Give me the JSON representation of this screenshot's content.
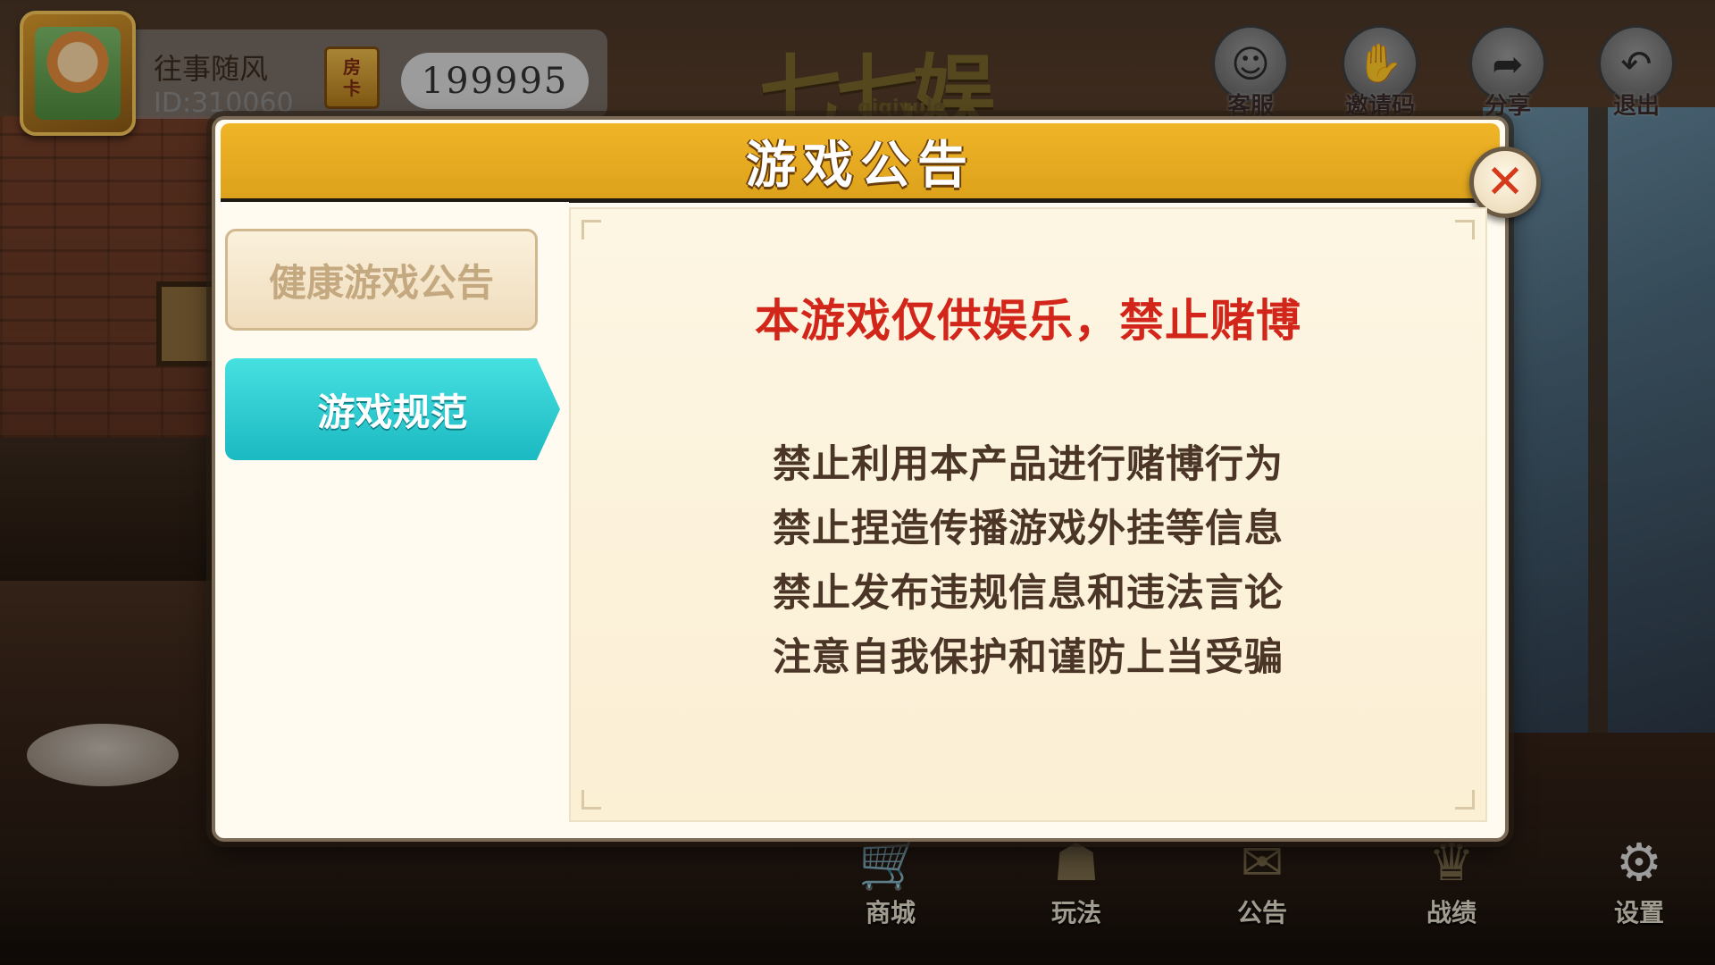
{
  "header": {
    "username": "往事随风",
    "user_id": "ID:310060",
    "room_card_label": "房\n卡",
    "coins": "199995",
    "logo_text": "七七娱乐",
    "logo_sub": "qiqiyule"
  },
  "top_icons": [
    {
      "label": "客服",
      "icon": "support-agent-icon"
    },
    {
      "label": "邀请码",
      "icon": "handshake-icon"
    },
    {
      "label": "分享",
      "icon": "share-icon"
    },
    {
      "label": "退出",
      "icon": "exit-icon"
    }
  ],
  "bottom_icons": [
    {
      "label": "商城",
      "icon": "cart-icon"
    },
    {
      "label": "玩法",
      "icon": "rules-icon"
    },
    {
      "label": "公告",
      "icon": "mail-icon"
    },
    {
      "label": "战绩",
      "icon": "trophy-icon"
    },
    {
      "label": "设置",
      "icon": "gear-icon"
    }
  ],
  "dialog": {
    "title": "游戏公告",
    "tabs": [
      {
        "label": "健康游戏公告",
        "active": false
      },
      {
        "label": "游戏规范",
        "active": true
      }
    ],
    "headline": "本游戏仅供娱乐，禁止赌博",
    "rules": [
      "禁止利用本产品进行赌博行为",
      "禁止捏造传播游戏外挂等信息",
      "禁止发布违规信息和违法言论",
      "注意自我保护和谨防上当受骗"
    ],
    "colors": {
      "header": "#dca21b",
      "active_tab": "#1bb9c2",
      "headline": "#d3261a"
    }
  }
}
